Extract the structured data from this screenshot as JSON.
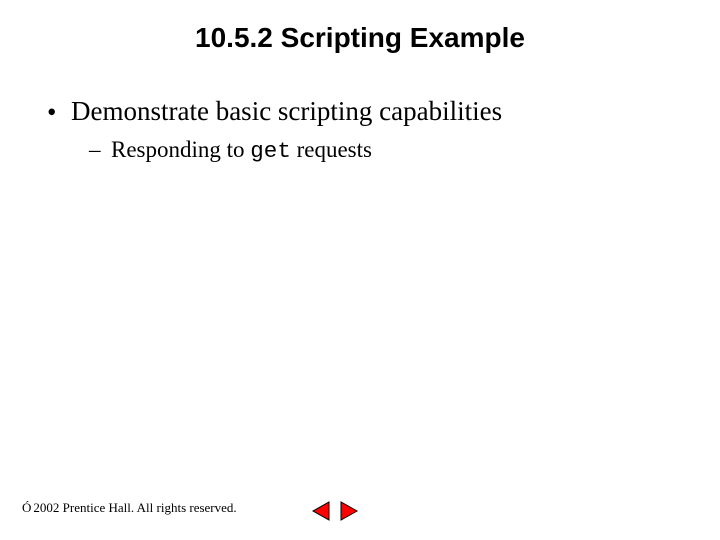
{
  "title": "10.5.2   Scripting Example",
  "bullets": {
    "l1": "Demonstrate basic scripting capabilities",
    "l2_pre": "Responding to ",
    "l2_code": "get",
    "l2_post": " requests"
  },
  "footer": {
    "symbol": "Ó",
    "text": " 2002 Prentice Hall. All rights reserved."
  },
  "nav": {
    "prev": "previous-slide",
    "next": "next-slide"
  }
}
